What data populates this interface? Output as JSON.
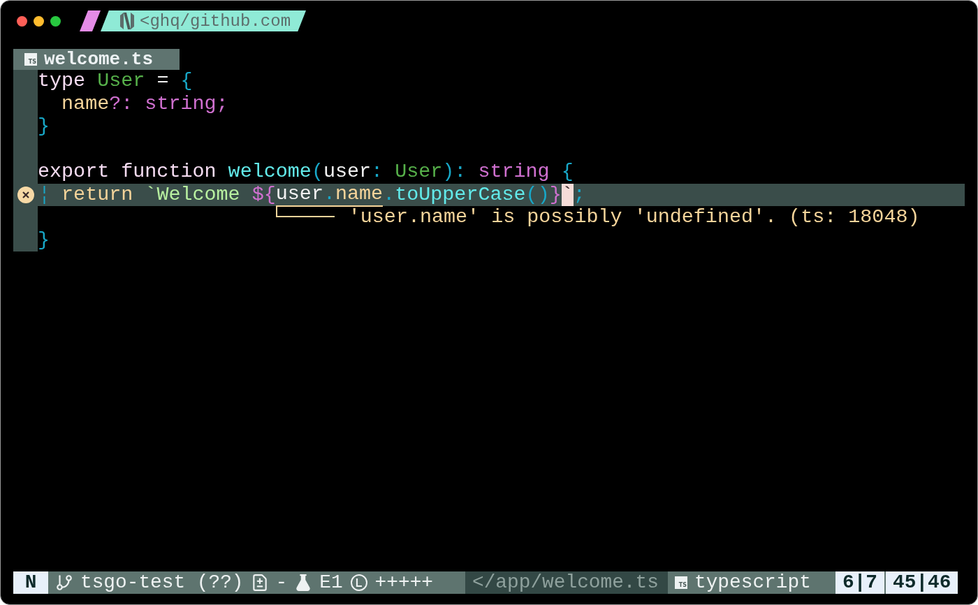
{
  "window": {
    "buttons": [
      {
        "kind": "close"
      },
      {
        "kind": "minimize"
      },
      {
        "kind": "zoom"
      }
    ]
  },
  "prompt": {
    "path": "<ghq/github.com"
  },
  "tab": {
    "file_badge": "TS",
    "title": "welcome.ts"
  },
  "lines": [
    {
      "selected": false,
      "error": false,
      "tokens": [
        {
          "text": "type ",
          "kind": "keyword"
        },
        {
          "text": "User",
          "kind": "type"
        },
        {
          "text": " = ",
          "kind": "plain"
        },
        {
          "text": "{",
          "kind": "punct"
        }
      ]
    },
    {
      "selected": false,
      "error": false,
      "tokens": [
        {
          "text": "  name",
          "kind": "prop"
        },
        {
          "text": "?: ",
          "kind": "builtin"
        },
        {
          "text": "string",
          "kind": "builtin"
        },
        {
          "text": ";",
          "kind": "builtin"
        }
      ]
    },
    {
      "selected": false,
      "error": false,
      "tokens": [
        {
          "text": "}",
          "kind": "punct"
        }
      ]
    },
    {
      "selected": false,
      "error": false
    },
    {
      "selected": false,
      "error": false,
      "tokens": [
        {
          "text": "export function ",
          "kind": "keyword"
        },
        {
          "text": "welcome",
          "kind": "func"
        },
        {
          "text": "(",
          "kind": "punct"
        },
        {
          "text": "user",
          "kind": "plain"
        },
        {
          "text": ": ",
          "kind": "punct"
        },
        {
          "text": "User",
          "kind": "type"
        },
        {
          "text": ")",
          "kind": "punct"
        },
        {
          "text": ": ",
          "kind": "punct"
        },
        {
          "text": "string ",
          "kind": "builtin"
        },
        {
          "text": "{",
          "kind": "punct"
        }
      ]
    },
    {
      "selected": true,
      "error": true,
      "tokens": [
        {
          "text": "  return ",
          "kind": "prop",
          "underlined": false,
          "cursor": false
        },
        {
          "text": "`Welcome ",
          "kind": "string",
          "underlined": false,
          "cursor": false
        },
        {
          "text": "${",
          "kind": "builtin",
          "underlined": false,
          "cursor": false
        },
        {
          "text": "user",
          "kind": "plain",
          "underlined": true,
          "cursor": false
        },
        {
          "text": ".",
          "kind": "punct",
          "underlined": true,
          "cursor": false
        },
        {
          "text": "name",
          "kind": "prop",
          "underlined": true,
          "cursor": false
        },
        {
          "text": ".",
          "kind": "punct",
          "underlined": false,
          "cursor": false
        },
        {
          "text": "toUpperCase",
          "kind": "func",
          "underlined": false,
          "cursor": false
        },
        {
          "text": "()",
          "kind": "punct",
          "underlined": false,
          "cursor": false
        },
        {
          "text": "}",
          "kind": "builtin",
          "underlined": false,
          "cursor": false
        },
        {
          "text": "`",
          "kind": "string",
          "underlined": false,
          "cursor": true
        },
        {
          "text": ";",
          "kind": "punct",
          "underlined": false,
          "cursor": false
        }
      ]
    },
    {
      "selected": false,
      "error": false,
      "diagnostic": "'user.name' is possibly 'undefined'. (ts: 18048)"
    },
    {
      "selected": false,
      "error": false,
      "tokens": [
        {
          "text": "}",
          "kind": "punct"
        }
      ]
    }
  ],
  "statusbar": {
    "mode": "N",
    "segments": [
      {
        "kind": "branch",
        "text": "tsgo-test (??)"
      },
      {
        "kind": "diff",
        "text": "-"
      },
      {
        "kind": "test",
        "text": "E1"
      },
      {
        "kind": "lint",
        "text": "+++++"
      }
    ],
    "path": "</app/welcome.ts",
    "file_badge": "TS",
    "filetype": "typescript",
    "positions": [
      "6|7",
      "45|46"
    ]
  }
}
